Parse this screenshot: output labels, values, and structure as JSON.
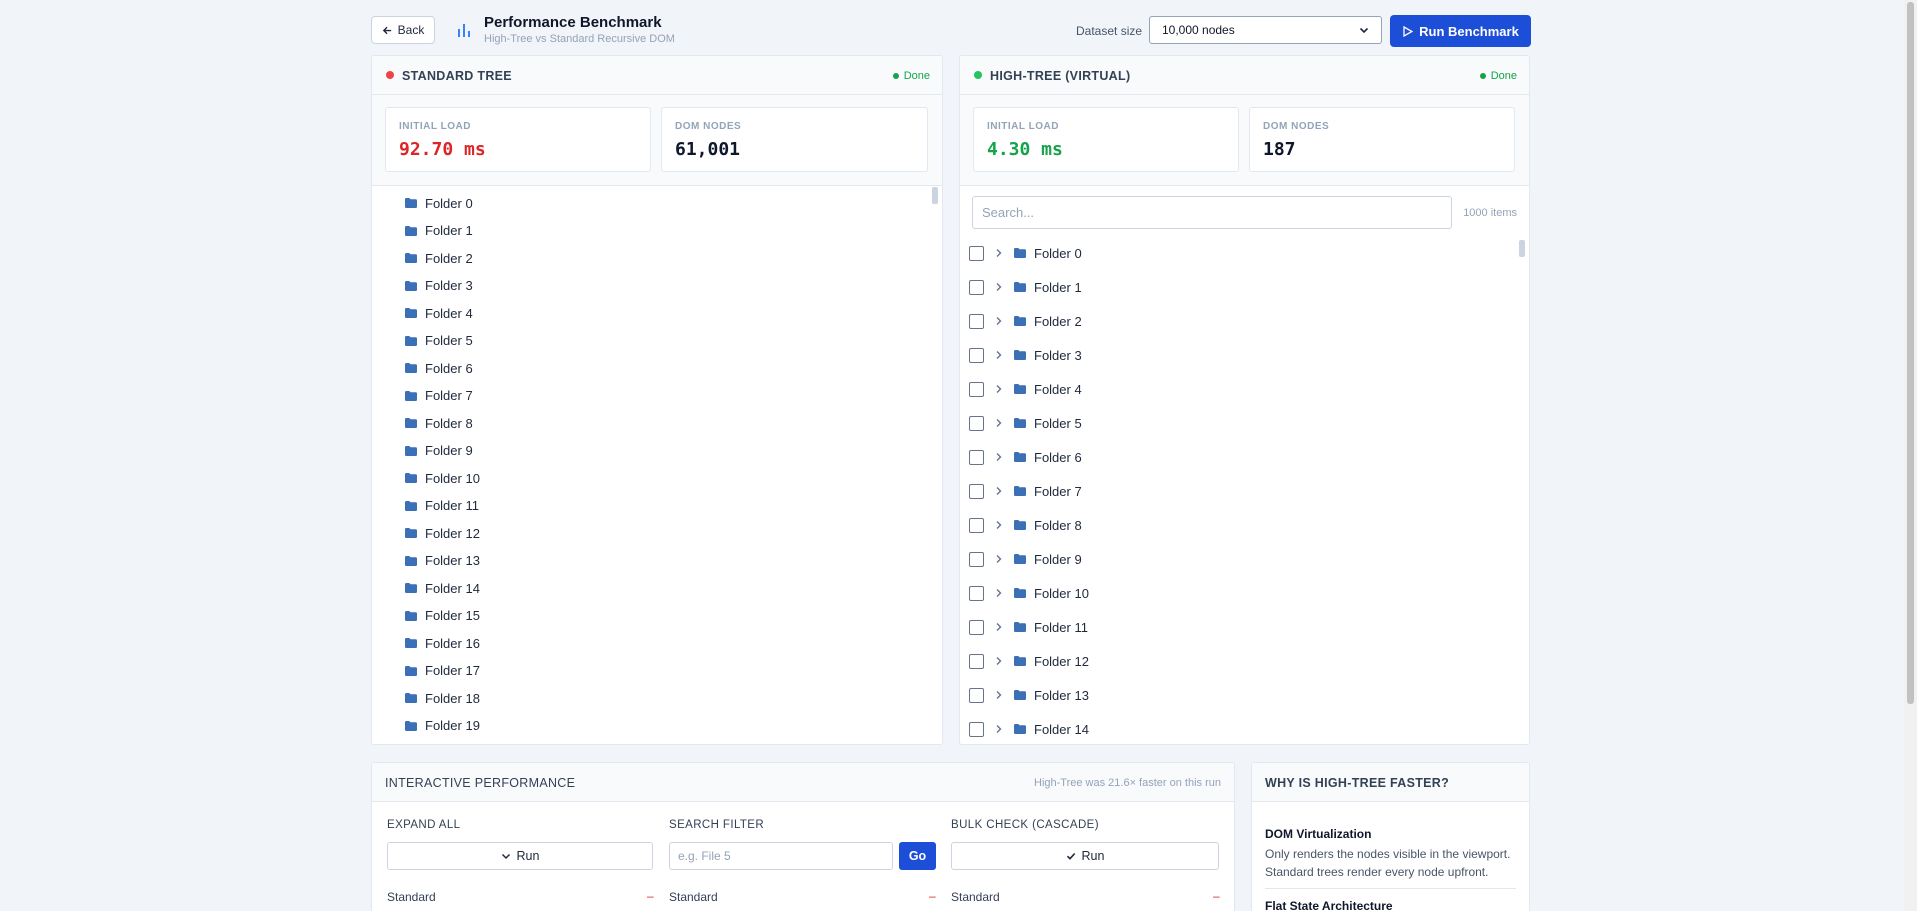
{
  "header": {
    "back_label": "Back",
    "title": "Performance Benchmark",
    "subtitle": "High-Tree vs Standard Recursive DOM",
    "dataset_label": "Dataset size",
    "dataset_value": "10,000 nodes",
    "run_label": "Run Benchmark"
  },
  "standard": {
    "title": "STANDARD TREE",
    "status": "Done",
    "dot_color": "#ef4444",
    "initial_load_label": "INITIAL LOAD",
    "initial_load_value": "92.70 ms",
    "initial_load_color": "#dc2626",
    "dom_nodes_label": "DOM NODES",
    "dom_nodes_value": "61,001",
    "folders": [
      "Folder 0",
      "Folder 1",
      "Folder 2",
      "Folder 3",
      "Folder 4",
      "Folder 5",
      "Folder 6",
      "Folder 7",
      "Folder 8",
      "Folder 9",
      "Folder 10",
      "Folder 11",
      "Folder 12",
      "Folder 13",
      "Folder 14",
      "Folder 15",
      "Folder 16",
      "Folder 17",
      "Folder 18",
      "Folder 19"
    ]
  },
  "virtual": {
    "title": "HIGH-TREE (VIRTUAL)",
    "status": "Done",
    "dot_color": "#22c55e",
    "initial_load_label": "INITIAL LOAD",
    "initial_load_value": "4.30 ms",
    "initial_load_color": "#16a34a",
    "dom_nodes_label": "DOM NODES",
    "dom_nodes_value": "187",
    "search_placeholder": "Search...",
    "items_count": "1000 items",
    "folders": [
      "Folder 0",
      "Folder 1",
      "Folder 2",
      "Folder 3",
      "Folder 4",
      "Folder 5",
      "Folder 6",
      "Folder 7",
      "Folder 8",
      "Folder 9",
      "Folder 10",
      "Folder 11",
      "Folder 12",
      "Folder 13",
      "Folder 14"
    ]
  },
  "interactive": {
    "title": "INTERACTIVE PERFORMANCE",
    "note": "High-Tree was 21.6× faster on this run",
    "expand_all": {
      "label": "EXPAND ALL",
      "button": "Run",
      "row_label": "Standard",
      "row_value": "–"
    },
    "search_filter": {
      "label": "SEARCH FILTER",
      "placeholder": "e.g. File 5",
      "button": "Go",
      "row_label": "Standard",
      "row_value": "–"
    },
    "bulk_check": {
      "label": "BULK CHECK (CASCADE)",
      "button": "Run",
      "row_label": "Standard",
      "row_value": "–"
    }
  },
  "why": {
    "title": "WHY IS HIGH-TREE FASTER?",
    "items": [
      {
        "title": "DOM Virtualization",
        "desc": "Only renders the nodes visible in the viewport. Standard trees render every node upfront."
      },
      {
        "title": "Flat State Architecture",
        "desc": ""
      }
    ]
  },
  "colors": {
    "accent": "#1d4ed8",
    "folder": "#3b6fb6"
  },
  "icons": {
    "back": "arrow-left-icon",
    "chart": "bar-chart-icon",
    "run": "play-icon",
    "folder": "folder-icon",
    "chevron": "chevron-right-icon"
  }
}
